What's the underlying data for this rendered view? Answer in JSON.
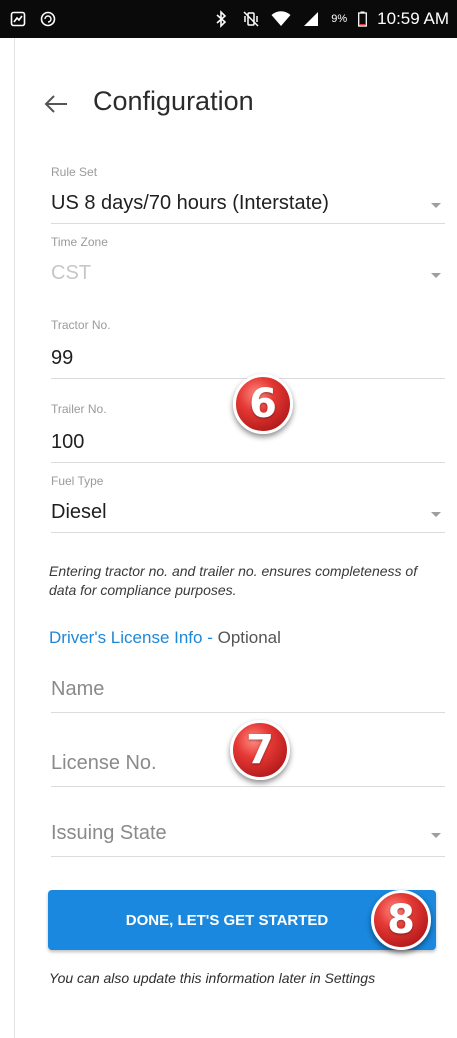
{
  "status_bar": {
    "left_icons": [
      "notification-icon",
      "sync-icon"
    ],
    "right_icons": [
      "bluetooth-icon",
      "vibrate-icon",
      "wifi-icon",
      "signal-icon"
    ],
    "battery_percent": "9%",
    "time": "10:59 AM"
  },
  "header": {
    "title": "Configuration"
  },
  "form": {
    "rule_set": {
      "label": "Rule Set",
      "value": "US 8 days/70 hours (Interstate)"
    },
    "time_zone": {
      "label": "Time Zone",
      "value": "CST"
    },
    "tractor_no": {
      "label": "Tractor No.",
      "value": "99"
    },
    "trailer_no": {
      "label": "Trailer No.",
      "value": "100"
    },
    "fuel_type": {
      "label": "Fuel Type",
      "value": "Diesel"
    },
    "note": "Entering tractor no. and trailer no. ensures completeness of data for compliance purposes."
  },
  "license": {
    "link": "Driver's License Info",
    "separator": " - ",
    "optional": "Optional",
    "name_placeholder": "Name",
    "license_no_placeholder": "License No.",
    "issuing_state_placeholder": "Issuing State"
  },
  "done_button": "DONE, LET'S GET STARTED",
  "footer_note": "You can also update this information later in Settings",
  "badges": [
    "6",
    "7",
    "8"
  ],
  "colors": {
    "accent": "#1a88de",
    "badge": "#d32f2f",
    "status_bar": "#0a0a0a"
  }
}
